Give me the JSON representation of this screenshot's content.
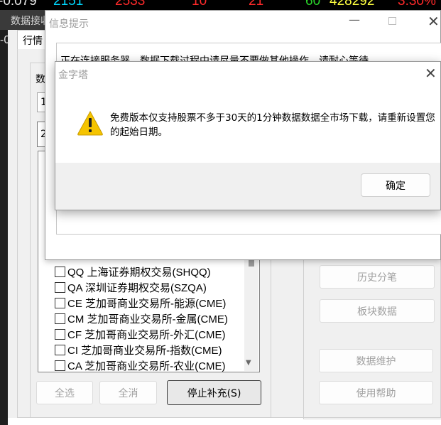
{
  "ticker": {
    "values": [
      "-0.079",
      "2151",
      "2533",
      "10",
      "21",
      "60",
      "428292",
      "3.30%"
    ],
    "left_marker": "-0"
  },
  "main_window": {
    "title": "数据接收",
    "tab_label": "行情",
    "group_label": "数",
    "stub_field_1": "1",
    "stub_field_2": "2",
    "list_items": [
      "QQ 上海证券期权交易(SHQQ)",
      "QA 深圳证券期权交易(SZQA)",
      "CE 芝加哥商业交易所-能源(CME)",
      "CM 芝加哥商业交易所-金属(CME)",
      "CF 芝加哥商业交易所-外汇(CME)",
      "CI 芝加哥商业交易所-指数(CME)",
      "CA 芝加哥商业交易所-农业(CME)"
    ],
    "buttons": {
      "select_all": "全选",
      "deselect_all": "全消",
      "stop_supplement": "停止补充(S)",
      "history_trades": "历史分笔",
      "sector_data": "板块数据",
      "data_maintenance": "数据维护",
      "help": "使用帮助"
    }
  },
  "info_window": {
    "title": "信息提示",
    "message": "正在连接服务器，数据下载过程中请尽量不要做其他操作，请耐心等待..."
  },
  "alert_dialog": {
    "title": "金字塔",
    "message": "免费版本仅支持股票不多于30天的1分钟数据数据全市场下载，请重新设置您的起始日期。",
    "ok_label": "确定",
    "icon": "warning-icon",
    "icon_color": "#f5c400"
  }
}
